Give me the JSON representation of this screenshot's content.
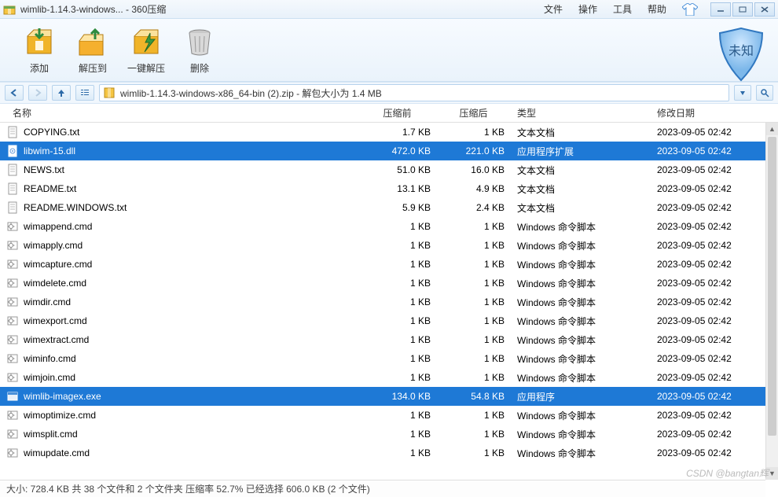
{
  "titlebar": {
    "title": "wimlib-1.14.3-windows... - 360压缩",
    "menus": [
      "文件",
      "操作",
      "工具",
      "帮助"
    ]
  },
  "toolbar": {
    "items": [
      {
        "label": "添加",
        "icon": "box-add"
      },
      {
        "label": "解压到",
        "icon": "box-extract"
      },
      {
        "label": "一键解压",
        "icon": "box-quick"
      },
      {
        "label": "删除",
        "icon": "trash"
      }
    ],
    "shield_text": "未知"
  },
  "pathbar": {
    "text": "wimlib-1.14.3-windows-x86_64-bin (2).zip - 解包大小为 1.4 MB"
  },
  "columns": {
    "name": "名称",
    "before": "压缩前",
    "after": "压缩后",
    "type": "类型",
    "date": "修改日期"
  },
  "files": [
    {
      "name": "COPYING.txt",
      "before": "1.7 KB",
      "after": "1 KB",
      "type": "文本文档",
      "date": "2023-09-05 02:42",
      "icon": "txt",
      "sel": false
    },
    {
      "name": "libwim-15.dll",
      "before": "472.0 KB",
      "after": "221.0 KB",
      "type": "应用程序扩展",
      "date": "2023-09-05 02:42",
      "icon": "dll",
      "sel": true
    },
    {
      "name": "NEWS.txt",
      "before": "51.0 KB",
      "after": "16.0 KB",
      "type": "文本文档",
      "date": "2023-09-05 02:42",
      "icon": "txt",
      "sel": false
    },
    {
      "name": "README.txt",
      "before": "13.1 KB",
      "after": "4.9 KB",
      "type": "文本文档",
      "date": "2023-09-05 02:42",
      "icon": "txt",
      "sel": false
    },
    {
      "name": "README.WINDOWS.txt",
      "before": "5.9 KB",
      "after": "2.4 KB",
      "type": "文本文档",
      "date": "2023-09-05 02:42",
      "icon": "txt",
      "sel": false
    },
    {
      "name": "wimappend.cmd",
      "before": "1 KB",
      "after": "1 KB",
      "type": "Windows 命令脚本",
      "date": "2023-09-05 02:42",
      "icon": "cmd",
      "sel": false
    },
    {
      "name": "wimapply.cmd",
      "before": "1 KB",
      "after": "1 KB",
      "type": "Windows 命令脚本",
      "date": "2023-09-05 02:42",
      "icon": "cmd",
      "sel": false
    },
    {
      "name": "wimcapture.cmd",
      "before": "1 KB",
      "after": "1 KB",
      "type": "Windows 命令脚本",
      "date": "2023-09-05 02:42",
      "icon": "cmd",
      "sel": false
    },
    {
      "name": "wimdelete.cmd",
      "before": "1 KB",
      "after": "1 KB",
      "type": "Windows 命令脚本",
      "date": "2023-09-05 02:42",
      "icon": "cmd",
      "sel": false
    },
    {
      "name": "wimdir.cmd",
      "before": "1 KB",
      "after": "1 KB",
      "type": "Windows 命令脚本",
      "date": "2023-09-05 02:42",
      "icon": "cmd",
      "sel": false
    },
    {
      "name": "wimexport.cmd",
      "before": "1 KB",
      "after": "1 KB",
      "type": "Windows 命令脚本",
      "date": "2023-09-05 02:42",
      "icon": "cmd",
      "sel": false
    },
    {
      "name": "wimextract.cmd",
      "before": "1 KB",
      "after": "1 KB",
      "type": "Windows 命令脚本",
      "date": "2023-09-05 02:42",
      "icon": "cmd",
      "sel": false
    },
    {
      "name": "wiminfo.cmd",
      "before": "1 KB",
      "after": "1 KB",
      "type": "Windows 命令脚本",
      "date": "2023-09-05 02:42",
      "icon": "cmd",
      "sel": false
    },
    {
      "name": "wimjoin.cmd",
      "before": "1 KB",
      "after": "1 KB",
      "type": "Windows 命令脚本",
      "date": "2023-09-05 02:42",
      "icon": "cmd",
      "sel": false
    },
    {
      "name": "wimlib-imagex.exe",
      "before": "134.0 KB",
      "after": "54.8 KB",
      "type": "应用程序",
      "date": "2023-09-05 02:42",
      "icon": "exe",
      "sel": true
    },
    {
      "name": "wimoptimize.cmd",
      "before": "1 KB",
      "after": "1 KB",
      "type": "Windows 命令脚本",
      "date": "2023-09-05 02:42",
      "icon": "cmd",
      "sel": false
    },
    {
      "name": "wimsplit.cmd",
      "before": "1 KB",
      "after": "1 KB",
      "type": "Windows 命令脚本",
      "date": "2023-09-05 02:42",
      "icon": "cmd",
      "sel": false
    },
    {
      "name": "wimupdate.cmd",
      "before": "1 KB",
      "after": "1 KB",
      "type": "Windows 命令脚本",
      "date": "2023-09-05 02:42",
      "icon": "cmd",
      "sel": false
    }
  ],
  "status": "大小: 728.4 KB 共 38 个文件和 2 个文件夹 压缩率 52.7% 已经选择 606.0 KB (2 个文件)",
  "watermark": "CSDN @bangtan辉"
}
